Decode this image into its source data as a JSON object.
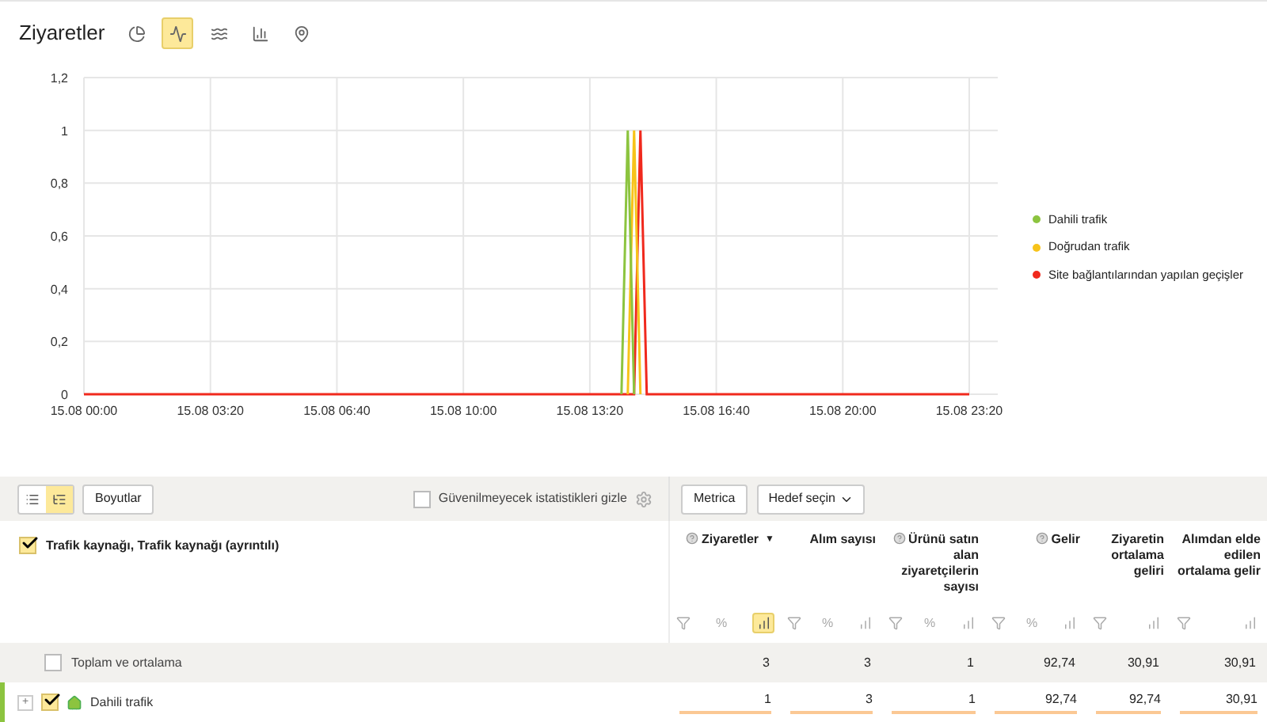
{
  "title": "Ziyaretler",
  "chart_types": [
    {
      "kind": "pie",
      "selected": false
    },
    {
      "kind": "line",
      "selected": true
    },
    {
      "kind": "area",
      "selected": false
    },
    {
      "kind": "bars",
      "selected": false
    },
    {
      "kind": "map",
      "selected": false
    }
  ],
  "chart": {
    "chart_data": {
      "type": "line",
      "grid": true,
      "ylim": [
        0,
        1.2
      ],
      "categories": [
        "15.08 00:00",
        null,
        null,
        null,
        null,
        null,
        null,
        null,
        null,
        null,
        null,
        null,
        null,
        null,
        null,
        null,
        null,
        null,
        null,
        null,
        "15.08 03:20",
        null,
        null,
        null,
        null,
        null,
        null,
        null,
        null,
        null,
        null,
        null,
        null,
        null,
        null,
        null,
        null,
        null,
        null,
        null,
        "15.08 06:40",
        null,
        null,
        null,
        null,
        null,
        null,
        null,
        null,
        null,
        null,
        null,
        null,
        null,
        null,
        null,
        null,
        null,
        null,
        null,
        "15.08 10:00",
        null,
        null,
        null,
        null,
        null,
        null,
        null,
        null,
        null,
        null,
        null,
        null,
        null,
        null,
        null,
        null,
        null,
        null,
        null,
        "15.08 13:20",
        null,
        null,
        null,
        null,
        null,
        null,
        null,
        null,
        null,
        null,
        null,
        null,
        null,
        null,
        null,
        null,
        null,
        null,
        null,
        "15.08 16:40",
        null,
        null,
        null,
        null,
        null,
        null,
        null,
        null,
        null,
        null,
        null,
        null,
        null,
        null,
        null,
        null,
        null,
        null,
        null,
        "15.08 20:00",
        null,
        null,
        null,
        null,
        null,
        null,
        null,
        null,
        null,
        null,
        null,
        null,
        null,
        null,
        null,
        null,
        null,
        null,
        null,
        "15.08 23:20"
      ],
      "yticks": [
        {
          "value": 0,
          "label": "0"
        },
        {
          "value": 0.2,
          "label": "0,2"
        },
        {
          "value": 0.4,
          "label": "0,4"
        },
        {
          "value": 0.6,
          "label": "0,6"
        },
        {
          "value": 0.8,
          "label": "0,8"
        },
        {
          "value": 1,
          "label": "1"
        },
        {
          "value": 1.2,
          "label": "1,2"
        }
      ],
      "series": [
        {
          "name": "Dahili trafik",
          "color": "#8cc43f",
          "values": [
            null,
            null,
            null,
            null,
            null,
            null,
            null,
            null,
            null,
            null,
            null,
            null,
            null,
            null,
            null,
            null,
            null,
            null,
            null,
            null,
            null,
            null,
            null,
            null,
            null,
            null,
            null,
            null,
            null,
            null,
            null,
            null,
            null,
            null,
            null,
            null,
            null,
            null,
            null,
            null,
            null,
            null,
            null,
            null,
            null,
            null,
            null,
            null,
            null,
            null,
            null,
            null,
            null,
            null,
            null,
            null,
            null,
            null,
            null,
            null,
            null,
            null,
            null,
            null,
            null,
            null,
            null,
            null,
            null,
            null,
            null,
            null,
            null,
            null,
            null,
            null,
            null,
            null,
            null,
            null,
            null,
            null,
            null,
            null,
            null,
            0,
            1,
            0,
            null,
            null,
            null,
            null,
            null,
            null,
            null,
            null,
            null,
            null,
            null,
            null,
            null,
            null,
            null,
            null,
            null,
            null,
            null,
            null,
            null,
            null,
            null,
            null,
            null,
            null,
            null,
            null,
            null,
            null,
            null,
            null,
            null,
            null,
            null,
            null,
            null,
            null,
            null,
            null,
            null,
            null,
            null,
            null,
            null,
            null,
            null,
            null,
            null,
            null,
            null,
            null,
            null
          ]
        },
        {
          "name": "Doğrudan trafik",
          "color": "#f7c31a",
          "values": [
            null,
            null,
            null,
            null,
            null,
            null,
            null,
            null,
            null,
            null,
            null,
            null,
            null,
            null,
            null,
            null,
            null,
            null,
            null,
            null,
            null,
            null,
            null,
            null,
            null,
            null,
            null,
            null,
            null,
            null,
            null,
            null,
            null,
            null,
            null,
            null,
            null,
            null,
            null,
            null,
            null,
            null,
            null,
            null,
            null,
            null,
            null,
            null,
            null,
            null,
            null,
            null,
            null,
            null,
            null,
            null,
            null,
            null,
            null,
            null,
            null,
            null,
            null,
            null,
            null,
            null,
            null,
            null,
            null,
            null,
            null,
            null,
            null,
            null,
            null,
            null,
            null,
            null,
            null,
            null,
            null,
            null,
            null,
            null,
            null,
            null,
            0,
            1,
            0,
            null,
            null,
            null,
            null,
            null,
            null,
            null,
            null,
            null,
            null,
            null,
            null,
            null,
            null,
            null,
            null,
            null,
            null,
            null,
            null,
            null,
            null,
            null,
            null,
            null,
            null,
            null,
            null,
            null,
            null,
            null,
            null,
            null,
            null,
            null,
            null,
            null,
            null,
            null,
            null,
            null,
            null,
            null,
            null,
            null,
            null,
            null,
            null,
            null,
            null,
            null,
            null
          ]
        },
        {
          "name": "Site bağlantılarından yapılan geçişler",
          "color": "#f0291d",
          "values": [
            0,
            0,
            0,
            0,
            0,
            0,
            0,
            0,
            0,
            0,
            0,
            0,
            0,
            0,
            0,
            0,
            0,
            0,
            0,
            0,
            0,
            0,
            0,
            0,
            0,
            0,
            0,
            0,
            0,
            0,
            0,
            0,
            0,
            0,
            0,
            0,
            0,
            0,
            0,
            0,
            0,
            0,
            0,
            0,
            0,
            0,
            0,
            0,
            0,
            0,
            0,
            0,
            0,
            0,
            0,
            0,
            0,
            0,
            0,
            0,
            0,
            0,
            0,
            0,
            0,
            0,
            0,
            0,
            0,
            0,
            0,
            0,
            0,
            0,
            0,
            0,
            0,
            0,
            0,
            0,
            0,
            0,
            0,
            0,
            0,
            0,
            0,
            0,
            1,
            0,
            0,
            0,
            0,
            0,
            0,
            0,
            0,
            0,
            0,
            0,
            0,
            0,
            0,
            0,
            0,
            0,
            0,
            0,
            0,
            0,
            0,
            0,
            0,
            0,
            0,
            0,
            0,
            0,
            0,
            0,
            0,
            0,
            0,
            0,
            0,
            0,
            0,
            0,
            0,
            0,
            0,
            0,
            0,
            0,
            0,
            0,
            0,
            0,
            0,
            0,
            0
          ]
        }
      ]
    }
  },
  "toolbar": {
    "views": [
      {
        "kind": "list",
        "selected": false
      },
      {
        "kind": "tree",
        "selected": true
      }
    ],
    "dimensions_button": "Boyutlar",
    "hide_unreliable": {
      "label": "Güvenilmeyecek istatistikleri gizle",
      "checked": false
    },
    "metrica_button": "Metrica",
    "goal_select": "Hedef seçin"
  },
  "table": {
    "dimension_header": {
      "label": "Trafik kaynağı, Trafik kaynağı (ayrıntılı)",
      "checked": true
    },
    "columns": [
      {
        "label": "Ziyaretler",
        "help": true,
        "sort": "▼",
        "percent": "%",
        "chart_selected": true
      },
      {
        "label": "Alım sayısı",
        "help": false,
        "percent": "%",
        "chart_selected": false
      },
      {
        "label": "Ürünü satın alan ziyaretçilerin sayısı",
        "help": true,
        "percent": "%",
        "chart_selected": false
      },
      {
        "label": "Gelir",
        "help": true,
        "percent": "%",
        "chart_selected": false
      },
      {
        "label": "Ziyaretin ortalama geliri",
        "help": false,
        "chart_selected": false
      },
      {
        "label": "Alımdan elde edilen ortalama gelir",
        "help": false,
        "chart_selected": false
      }
    ],
    "totals": {
      "label": "Toplam ve ortalama",
      "checked": false,
      "values": [
        "3",
        "3",
        "1",
        "92,74",
        "30,91",
        "30,91"
      ]
    },
    "rows": [
      {
        "label": "Dahili trafik",
        "expand": "+",
        "checked": true,
        "color": "#8cc43f",
        "values": [
          "1",
          "3",
          "1",
          "92,74",
          "92,74",
          "30,91"
        ]
      }
    ]
  }
}
